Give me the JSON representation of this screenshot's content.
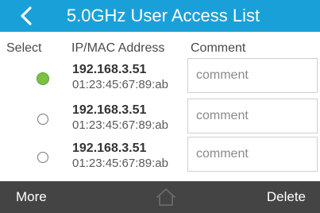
{
  "header": {
    "title": "5.0GHz User Access List",
    "back_icon": "chevron-left-icon",
    "bg_color": "#1aa0d8"
  },
  "columns": {
    "select": "Select",
    "ip_mac": "IP/MAC Address",
    "comment": "Comment"
  },
  "rows": [
    {
      "ip": "192.168.3.51",
      "mac": "01:23:45:67:89:ab",
      "comment_placeholder": "comment",
      "comment_value": "",
      "selected": true
    },
    {
      "ip": "192.168.3.51",
      "mac": "01:23:45:67:89:ab",
      "comment_placeholder": "comment",
      "comment_value": "",
      "selected": false
    },
    {
      "ip": "192.168.3.51",
      "mac": "01:23:45:67:89:ab",
      "comment_placeholder": "comment",
      "comment_value": "",
      "selected": false
    }
  ],
  "footer": {
    "more_label": "More",
    "home_icon": "home-icon",
    "delete_label": "Delete",
    "bg_color": "#444444"
  },
  "colors": {
    "selected_radio": "#7cc142"
  }
}
